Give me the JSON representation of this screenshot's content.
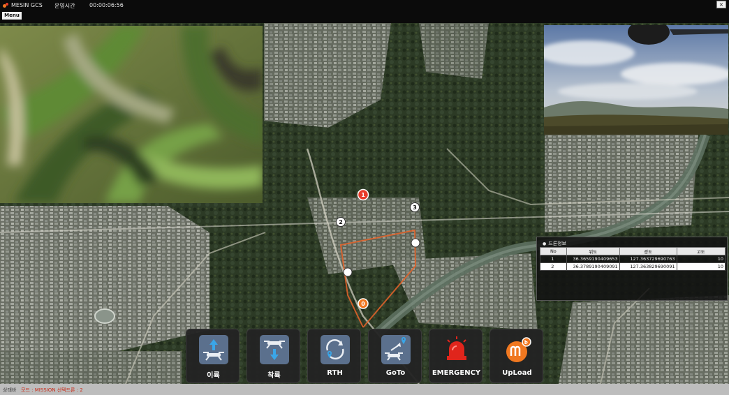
{
  "titlebar": {
    "app_name": "MESIN GCS",
    "op_time_label": "운영시간",
    "op_time_value": "00:00:06:56",
    "close_label": "×"
  },
  "menu": {
    "label": "Menu"
  },
  "map": {
    "waypoints": [
      "0",
      "1",
      "2",
      "3"
    ],
    "drone_marker": "1"
  },
  "drone_panel": {
    "title": "드론정보",
    "columns": [
      "No",
      "위도",
      "경도",
      "고도"
    ],
    "rows": [
      {
        "no": "1",
        "lat": "36.3659190409653",
        "lon": "127.363729690763",
        "alt": "10"
      },
      {
        "no": "2",
        "lat": "36.3789190409091",
        "lon": "127.363829690091",
        "alt": "10"
      }
    ],
    "selected_row": 2
  },
  "actions": [
    {
      "label": "이륙",
      "icon": "takeoff-icon"
    },
    {
      "label": "착륙",
      "icon": "landing-icon"
    },
    {
      "label": "RTH",
      "icon": "return-home-icon"
    },
    {
      "label": "GoTo",
      "icon": "goto-icon"
    },
    {
      "label": "EMERGENCY",
      "icon": "siren-icon"
    },
    {
      "label": "UpLoad",
      "icon": "upload-logo-icon"
    }
  ],
  "statusbar": {
    "label": "상태바",
    "text": "모드 : MISSION 선택드론 : 2"
  },
  "colors": {
    "accent_orange": "#f07820",
    "route": "#e8642a",
    "emergency_red": "#e0251c",
    "tile_blue": "#5b708d"
  }
}
